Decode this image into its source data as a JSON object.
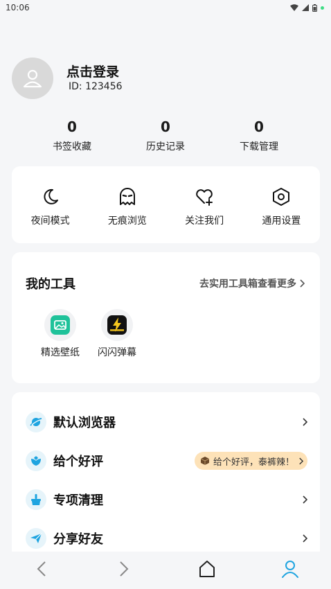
{
  "status_bar": {
    "time": "10:06"
  },
  "profile": {
    "title": "点击登录",
    "id_text": "ID: 123456"
  },
  "stats": [
    {
      "value": "0",
      "label": "书签收藏"
    },
    {
      "value": "0",
      "label": "历史记录"
    },
    {
      "value": "0",
      "label": "下载管理"
    }
  ],
  "quick_actions": [
    {
      "label": "夜间模式",
      "icon": "moon-icon"
    },
    {
      "label": "无痕浏览",
      "icon": "ghost-icon"
    },
    {
      "label": "关注我们",
      "icon": "heart-plus-icon"
    },
    {
      "label": "通用设置",
      "icon": "settings-hexagon-icon"
    }
  ],
  "tools": {
    "title": "我的工具",
    "more": "去实用工具箱查看更多",
    "items": [
      {
        "label": "精选壁纸",
        "icon": "wallpaper-icon"
      },
      {
        "label": "闪闪弹幕",
        "icon": "danmaku-icon"
      }
    ]
  },
  "menu": [
    {
      "label": "默认浏览器",
      "icon": "planet-icon"
    },
    {
      "label": "给个好评",
      "icon": "flower-icon",
      "promo": "给个好评，泰裤辣！"
    },
    {
      "label": "专项清理",
      "icon": "broom-icon"
    },
    {
      "label": "分享好友",
      "icon": "send-icon"
    }
  ],
  "colors": {
    "accent": "#1ea4e0",
    "promo_bg": "#fde2b8"
  }
}
